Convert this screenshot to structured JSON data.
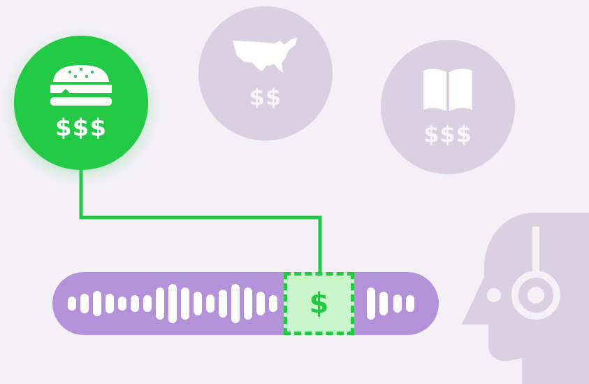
{
  "categories": [
    {
      "icon": "burger-icon",
      "price": "$$$",
      "active": true
    },
    {
      "icon": "usa-map-icon",
      "price": "$$",
      "active": false
    },
    {
      "icon": "book-icon",
      "price": "$$$",
      "active": false
    }
  ],
  "audio": {
    "marker_label": "$"
  },
  "colors": {
    "accent_green": "#22c944",
    "inactive_circle": "#d9d0e2",
    "audio_bar": "#b492da",
    "marker_fill": "#c8f5c9",
    "background": "#f3f0f6",
    "listener": "#d9d0e2"
  }
}
